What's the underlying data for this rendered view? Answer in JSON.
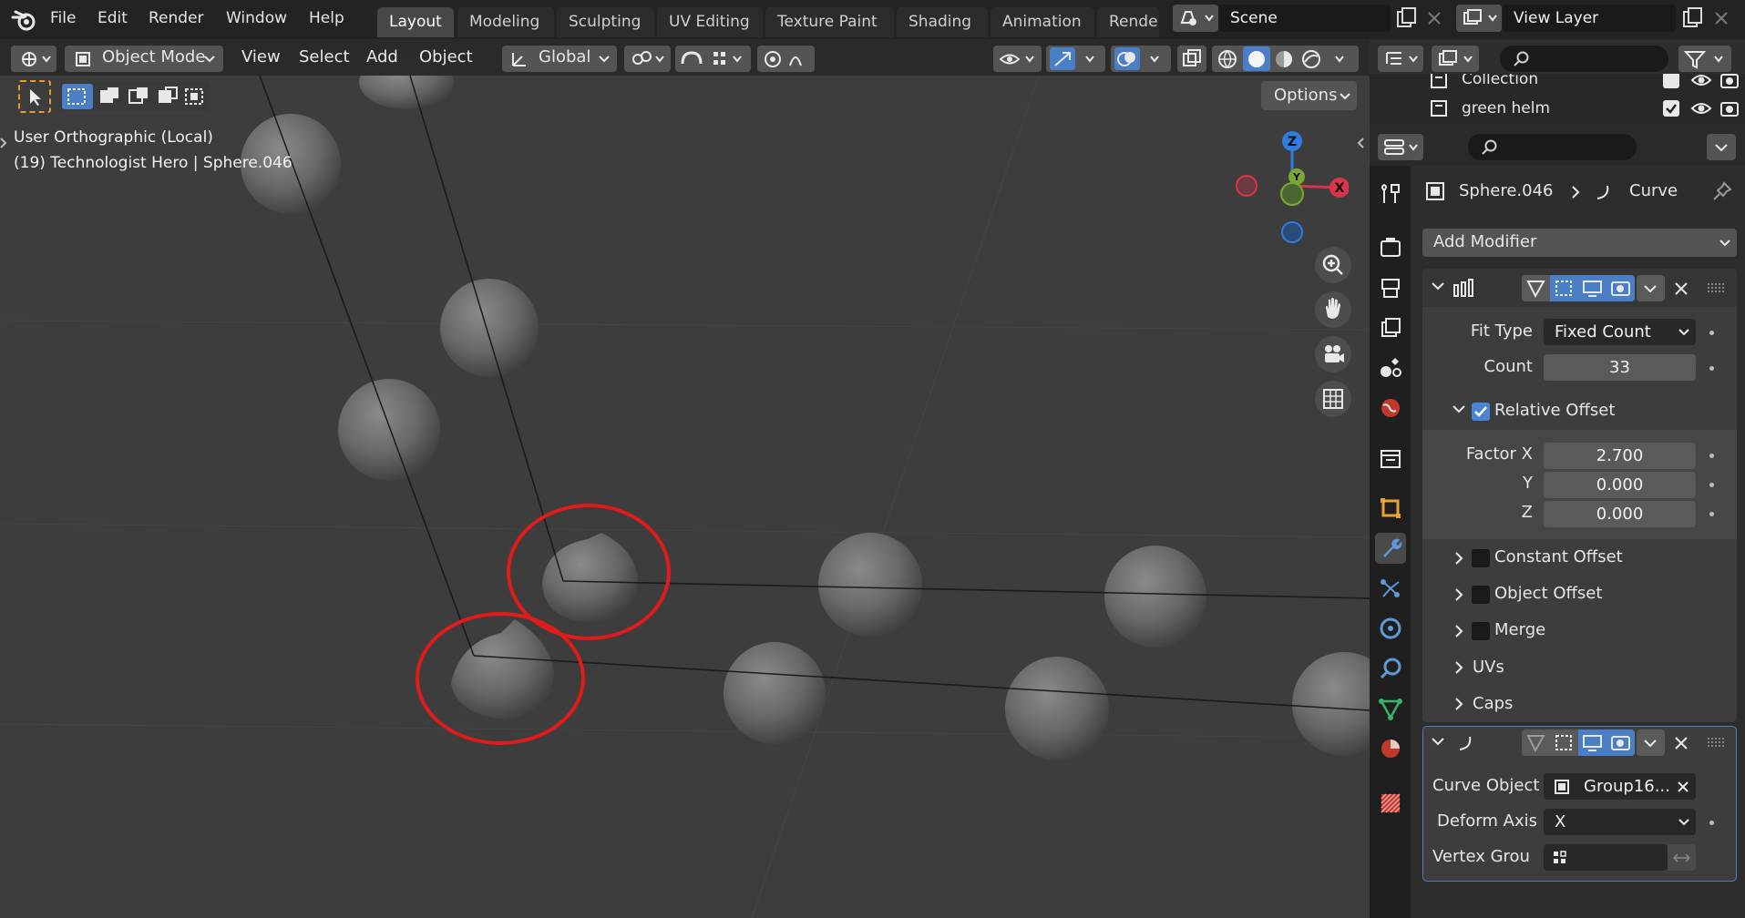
{
  "menu": [
    "File",
    "Edit",
    "Render",
    "Window",
    "Help"
  ],
  "workspaces": [
    "Layout",
    "Modeling",
    "Sculpting",
    "UV Editing",
    "Texture Paint",
    "Shading",
    "Animation",
    "Render"
  ],
  "active_workspace": "Layout",
  "scene": {
    "name": "Scene",
    "view_layer": "View Layer"
  },
  "viewport_header": {
    "mode": "Object Mode",
    "menus": [
      "View",
      "Select",
      "Add",
      "Object"
    ],
    "orientation": "Global",
    "options_label": "Options"
  },
  "viewport_info": {
    "line1": "User Orthographic (Local)",
    "line2": "(19) Technologist Hero | Sphere.046"
  },
  "gizmo": {
    "z": "Z",
    "y": "Y",
    "x": "X"
  },
  "outliner": {
    "rows": [
      {
        "name": "Collection"
      },
      {
        "name": "green helm"
      }
    ]
  },
  "properties": {
    "object_name": "Sphere.046",
    "modifier_breadcrumb": "Curve",
    "add_modifier_label": "Add Modifier",
    "array": {
      "fit_type_label": "Fit Type",
      "fit_type_value": "Fixed Count",
      "count_label": "Count",
      "count_value": "33",
      "relative_offset_label": "Relative Offset",
      "factor_x_label": "Factor X",
      "factor_x_value": "2.700",
      "y_label": "Y",
      "y_value": "0.000",
      "z_label": "Z",
      "z_value": "0.000",
      "constant_offset_label": "Constant Offset",
      "object_offset_label": "Object Offset",
      "merge_label": "Merge",
      "uvs_label": "UVs",
      "caps_label": "Caps"
    },
    "curve": {
      "curve_object_label": "Curve Object",
      "curve_object_value": "Group16...",
      "deform_axis_label": "Deform Axis",
      "deform_axis_value": "X",
      "vertex_group_label": "Vertex Grou"
    }
  },
  "colors": {
    "accent_blue": "#4a82d4",
    "annotation_red": "#e01b1b",
    "axis_x": "#d9344a",
    "axis_y": "#7aa833",
    "axis_z": "#2e7de0"
  }
}
